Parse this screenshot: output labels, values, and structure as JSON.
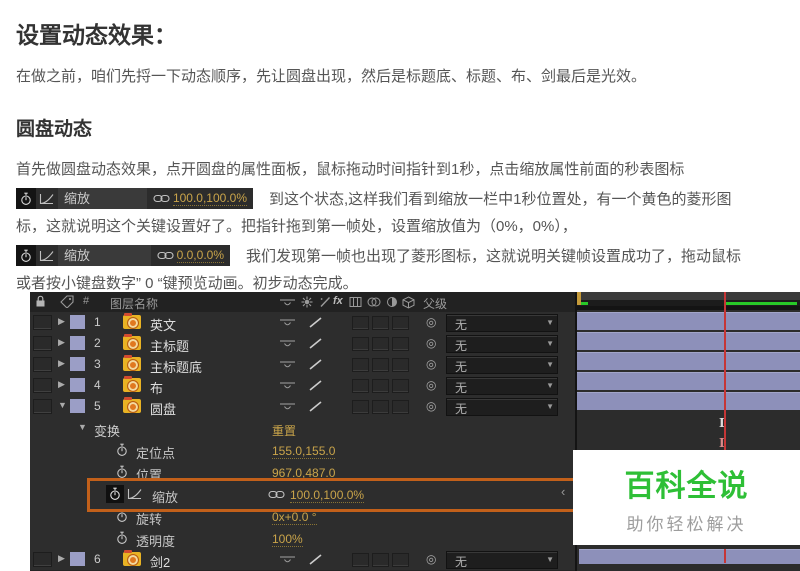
{
  "doc": {
    "title": "设置动态效果：",
    "intro": "在做之前，咱们先捋一下动态顺序，先让圆盘出现，然后是标题底、标题、布、剑最后是光效。",
    "section": "圆盘动态",
    "step1": "首先做圆盘动态效果，点开圆盘的属性面板，鼠标拖动时间指针到1秒，点击缩放属性前面的秒表图标",
    "after_strip1": "到这个状态,这样我们看到缩放一栏中1秒位置处，有一个黄色的菱形图",
    "line3": "标，这就说明这个关键设置好了。把指针拖到第一帧处，设置缩放值为（0%，0%），",
    "after_strip2": "我们发现第一帧也出现了菱形图标，这就说明关键帧设置成功了，拖动鼠标",
    "line5": "或者按小键盘数字” 0 “键预览动画。初步动态完成。",
    "strip1": {
      "label": "缩放",
      "value": "100.0,100.0%"
    },
    "strip2": {
      "label": "缩放",
      "value": "0.0,0.0%"
    }
  },
  "panel": {
    "header": {
      "index": "#",
      "layer_name": "图层名称",
      "parent": "父级",
      "fx": "fx"
    },
    "none_label": "无",
    "layers": [
      {
        "num": "1",
        "name": "英文"
      },
      {
        "num": "2",
        "name": "主标题"
      },
      {
        "num": "3",
        "name": "主标题底"
      },
      {
        "num": "4",
        "name": "布"
      },
      {
        "num": "5",
        "name": "圆盘"
      },
      {
        "num": "6",
        "name": "剑2"
      }
    ],
    "transform": {
      "label": "变换",
      "reset": "重置",
      "props": [
        {
          "label": "定位点",
          "value": "155.0,155.0"
        },
        {
          "label": "位置",
          "value": "967.0,487.0"
        },
        {
          "label": "缩放",
          "value": "100.0,100.0%"
        },
        {
          "label": "旋转",
          "value": "0x+0.0 °"
        },
        {
          "label": "透明度",
          "value": "100%"
        }
      ]
    }
  },
  "watermark": {
    "title": "百科全说",
    "subtitle": "助你轻松解决"
  },
  "colors": {
    "highlight_orange": "#c2601a",
    "value_yellow": "#c9a44a",
    "watermark_green": "#2ebf36",
    "layer_bar_lavender": "#8d90ba",
    "playhead_red": "#c63636",
    "cache_green": "#28c828"
  }
}
